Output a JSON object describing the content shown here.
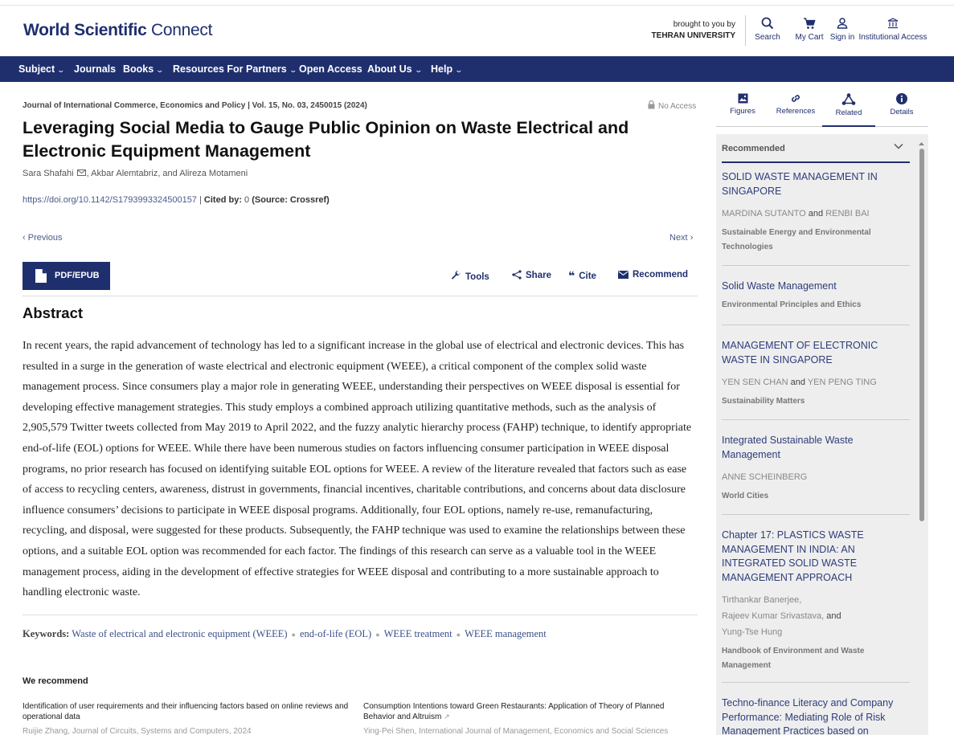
{
  "header": {
    "logo_bold": "World Scientific",
    "logo_light": "Connect",
    "brought_by": "brought to you by",
    "institution": "TEHRAN UNIVERSITY",
    "search": "Search",
    "cart": "My Cart",
    "signin": "Sign in",
    "institutional": "Institutional Access"
  },
  "nav": {
    "subject": "Subject",
    "journals": "Journals",
    "books": "Books",
    "resources": "Resources For Partners",
    "open_access": "Open Access",
    "about": "About Us",
    "help": "Help"
  },
  "article": {
    "journal_line": "Journal of International Commerce, Economics and Policy  |  Vol. 15, No. 03, 2450015 (2024)",
    "access": "No Access",
    "title": "Leveraging Social Media to Gauge Public Opinion on Waste Electrical and Electronic Equipment Management",
    "author1": "Sara Shafahi",
    "authors_rest": ", Akbar Alemtabriz, and Alireza Motameni",
    "doi": "https://doi.org/10.1142/S1793993324500157",
    "cited_label": "Cited by:",
    "cited_count": "0",
    "cited_source": "(Source: Crossref)",
    "previous": "Previous",
    "next": "Next",
    "pdf": "PDF/EPUB",
    "tools": "Tools",
    "share": "Share",
    "cite": "Cite",
    "recommend": "Recommend",
    "abstract_heading": "Abstract",
    "abstract": "In recent years, the rapid advancement of technology has led to a significant increase in the global use of electrical and electronic devices. This has resulted in a surge in the generation of waste electrical and electronic equipment (WEEE), a critical component of the complex solid waste management process. Since consumers play a major role in generating WEEE, understanding their perspectives on WEEE disposal is essential for developing effective management strategies. This study employs a combined approach utilizing quantitative methods, such as the analysis of 2,905,579 Twitter tweets collected from May 2019 to April 2022, and the fuzzy analytic hierarchy process (FAHP) technique, to identify appropriate end-of-life (EOL) options for WEEE. While there have been numerous studies on factors influencing consumer participation in WEEE disposal programs, no prior research has focused on identifying suitable EOL options for WEEE. A review of the literature revealed that factors such as ease of access to recycling centers, awareness, distrust in governments, financial incentives, charitable contributions, and concerns about data disclosure influence consumers’ decisions to participate in WEEE disposal programs. Additionally, four EOL options, namely re-use, remanufacturing, recycling, and disposal, were suggested for these products. Subsequently, the FAHP technique was used to examine the relationships between these options, and a suitable EOL option was recommended for each factor. The findings of this research can serve as a valuable tool in the WEEE management process, aiding in the development of effective strategies for WEEE disposal and contributing to a more sustainable approach to handling electronic waste.",
    "keywords_label": "Keywords:",
    "keywords": [
      "Waste of electrical and electronic equipment (WEEE)",
      "end-of-life (EOL)",
      "WEEE treatment",
      "WEEE management"
    ]
  },
  "we_recommend": {
    "heading": "We recommend",
    "items": [
      {
        "title": "Identification of user requirements and their influencing factors based on online reviews and operational data",
        "meta": "Ruijie Zhang, Journal of Circuits, Systems and Computers, 2024"
      },
      {
        "title": "Consumption Intentions toward Green Restaurants: Application of Theory of Planned Behavior and Altruism",
        "meta": "Ying-Pei Shen, International Journal of Management, Economics and Social Sciences"
      }
    ]
  },
  "sidebar": {
    "tabs": {
      "figures": "Figures",
      "references": "References",
      "related": "Related",
      "details": "Details"
    },
    "recommended": "Recommended",
    "items": [
      {
        "title": "SOLID WASTE MANAGEMENT IN SINGAPORE",
        "author_a": "MARDINA SUTANTO",
        "and": "and",
        "author_b": "RENBI BAI",
        "source": "Sustainable Energy and Environmental Technologies"
      },
      {
        "title": "Solid Waste Management",
        "source": "Environmental Principles and Ethics"
      },
      {
        "title": "MANAGEMENT OF ELECTRONIC WASTE IN SINGAPORE",
        "author_a": "YEN SEN CHAN",
        "and": "and",
        "author_b": "YEN PENG TING",
        "source": "Sustainability Matters"
      },
      {
        "title": "Integrated Sustainable Waste Management",
        "author_a": "ANNE SCHEINBERG",
        "source": "World Cities"
      },
      {
        "title": "Chapter 17: PLASTICS WASTE MANAGEMENT IN INDIA: AN INTEGRATED SOLID WASTE MANAGEMENT APPROACH",
        "author_1": "Tirthankar Banerjee,",
        "author_2": "Rajeev Kumar Srivastava,",
        "and": "and",
        "author_3": "Yung-Tse Hung",
        "source": "Handbook of Environment and Waste Management"
      },
      {
        "title": "Techno-finance Literacy and Company Performance: Mediating Role of Risk Management Practices based on"
      }
    ]
  },
  "colors": {
    "brand": "#1f2f6e",
    "link": "#2d3d7a",
    "panel_bg": "#eeeeee"
  }
}
